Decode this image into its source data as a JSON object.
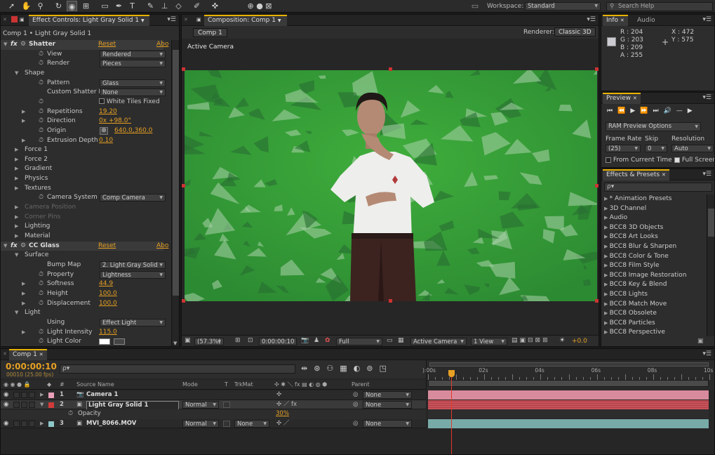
{
  "workspace": {
    "label": "Workspace:",
    "value": "Standard",
    "search_placeholder": "Search Help"
  },
  "effect_controls": {
    "tab_title": "Effect Controls: Light Gray Solid 1",
    "subtitle": "Comp 1 • Light Gray Solid 1",
    "rows": [
      {
        "indent": 0,
        "fx": true,
        "name": "Shatter",
        "reset": "Reset",
        "about": "Abo"
      },
      {
        "indent": 2,
        "stopwatch": true,
        "name": "View",
        "dropdown": "Rendered"
      },
      {
        "indent": 2,
        "stopwatch": true,
        "name": "Render",
        "dropdown": "Pieces"
      },
      {
        "indent": 1,
        "twirl": "open",
        "name": "Shape"
      },
      {
        "indent": 2,
        "stopwatch": true,
        "name": "Pattern",
        "dropdown": "Glass"
      },
      {
        "indent": 2,
        "name": "Custom Shatter Map",
        "dropdown": "None"
      },
      {
        "indent": 2,
        "stopwatch": true,
        "checkbox": false,
        "check_label": "White Tiles Fixed"
      },
      {
        "indent": 2,
        "twirl": "closed",
        "stopwatch": true,
        "name": "Repetitions",
        "value": "19.20"
      },
      {
        "indent": 2,
        "twirl": "closed",
        "stopwatch": true,
        "name": "Direction",
        "value": "0x +98.0°"
      },
      {
        "indent": 2,
        "stopwatch": true,
        "name": "Origin",
        "value": "640.0,360.0",
        "target": true
      },
      {
        "indent": 2,
        "twirl": "closed",
        "stopwatch": true,
        "name": "Extrusion Depth",
        "value": "0.10"
      },
      {
        "indent": 1,
        "twirl": "closed",
        "name": "Force 1"
      },
      {
        "indent": 1,
        "twirl": "closed",
        "name": "Force 2"
      },
      {
        "indent": 1,
        "twirl": "closed",
        "name": "Gradient"
      },
      {
        "indent": 1,
        "twirl": "closed",
        "name": "Physics"
      },
      {
        "indent": 1,
        "twirl": "closed",
        "name": "Textures"
      },
      {
        "indent": 2,
        "stopwatch": true,
        "name": "Camera System",
        "dropdown": "Comp Camera"
      },
      {
        "indent": 1,
        "twirl": "closed",
        "name": "Camera Position",
        "disabled": true
      },
      {
        "indent": 1,
        "twirl": "closed",
        "name": "Corner Pins",
        "disabled": true
      },
      {
        "indent": 1,
        "twirl": "closed",
        "name": "Lighting"
      },
      {
        "indent": 1,
        "twirl": "closed",
        "name": "Material"
      },
      {
        "indent": 0,
        "fx": true,
        "name": "CC Glass",
        "reset": "Reset",
        "about": "Abo"
      },
      {
        "indent": 1,
        "twirl": "open",
        "name": "Surface"
      },
      {
        "indent": 2,
        "name": "Bump Map",
        "dropdown": "2. Light Gray Solid"
      },
      {
        "indent": 2,
        "stopwatch": true,
        "name": "Property",
        "dropdown": "Lightness"
      },
      {
        "indent": 2,
        "twirl": "closed",
        "stopwatch": true,
        "name": "Softness",
        "value": "44.9"
      },
      {
        "indent": 2,
        "twirl": "closed",
        "stopwatch": true,
        "name": "Height",
        "value": "100.0"
      },
      {
        "indent": 2,
        "twirl": "closed",
        "stopwatch": true,
        "name": "Displacement",
        "value": "100.0"
      },
      {
        "indent": 1,
        "twirl": "open",
        "name": "Light"
      },
      {
        "indent": 2,
        "name": "Using",
        "dropdown": "Effect Light"
      },
      {
        "indent": 2,
        "twirl": "closed",
        "stopwatch": true,
        "name": "Light Intensity",
        "value": "115.0"
      },
      {
        "indent": 2,
        "stopwatch": true,
        "name": "Light Color",
        "swatch": "#ffffff"
      }
    ]
  },
  "composition": {
    "tab_title": "Composition: Comp 1",
    "sub_tab": "Comp 1",
    "renderer_label": "Renderer:",
    "renderer_value": "Classic 3D",
    "view_label": "Active Camera",
    "footer": {
      "zoom": "(57.3%)",
      "timecode": "0:00:00:10",
      "resolution": "Full",
      "camera": "Active Camera",
      "views": "1 View",
      "exposure": "+0.0"
    }
  },
  "info": {
    "tabs": [
      "Info",
      "Audio"
    ],
    "r": "R : 204",
    "g": "G : 203",
    "b": "B : 209",
    "a": "A : 255",
    "x": "X : 472",
    "y": "Y : 575",
    "swatch": "#cccbd1"
  },
  "preview": {
    "tab": "Preview",
    "ram_options": "RAM Preview Options",
    "frame_rate_label": "Frame Rate",
    "skip_label": "Skip",
    "resolution_label": "Resolution",
    "frame_rate": "(25)",
    "skip": "0",
    "resolution": "Auto",
    "from_current": "From Current Time",
    "full_screen": "Full Screen"
  },
  "effects_presets": {
    "tab": "Effects & Presets",
    "search_placeholder": "ρ▾",
    "items": [
      "* Animation Presets",
      "3D Channel",
      "Audio",
      "BCC8 3D Objects",
      "BCC8 Art Looks",
      "BCC8 Blur & Sharpen",
      "BCC8 Color & Tone",
      "BCC8 Film Style",
      "BCC8 Image Restoration",
      "BCC8 Key & Blend",
      "BCC8 Lights",
      "BCC8 Match Move",
      "BCC8 Obsolete",
      "BCC8 Particles",
      "BCC8 Perspective"
    ]
  },
  "timeline": {
    "tab": "Comp 1",
    "timecode": "0:00:00:10",
    "frame_info": "00010 (25.00 fps)",
    "columns": {
      "num": "#",
      "source": "Source Name",
      "mode": "Mode",
      "t": "T",
      "trkmat": "TrkMat",
      "parent": "Parent"
    },
    "ruler": [
      {
        "label": "):00s",
        "t": 0
      },
      {
        "label": "02s",
        "t": 2
      },
      {
        "label": "04s",
        "t": 4
      },
      {
        "label": "06s",
        "t": 6
      },
      {
        "label": "08s",
        "t": 8
      },
      {
        "label": "10s",
        "t": 10
      }
    ],
    "duration": 10,
    "current_time": 0.4,
    "layers": [
      {
        "num": "1",
        "name": "Camera 1",
        "color": "#e8a0b8",
        "parent": "None",
        "bar": "#d88b9c",
        "icon": "camera"
      },
      {
        "num": "2",
        "name": "Light Gray Solid 1",
        "color": "#d23b3b",
        "mode": "Normal",
        "parent": "None",
        "bar": "#c8525a",
        "selected": true,
        "fx": true
      },
      {
        "num": "3",
        "name": "MVI_8066.MOV",
        "color": "#8ec8c8",
        "mode": "Normal",
        "trkmat": "None",
        "parent": "None",
        "bar": "#78aaa8"
      }
    ],
    "opacity": {
      "label": "Opacity",
      "value": "30%"
    }
  }
}
